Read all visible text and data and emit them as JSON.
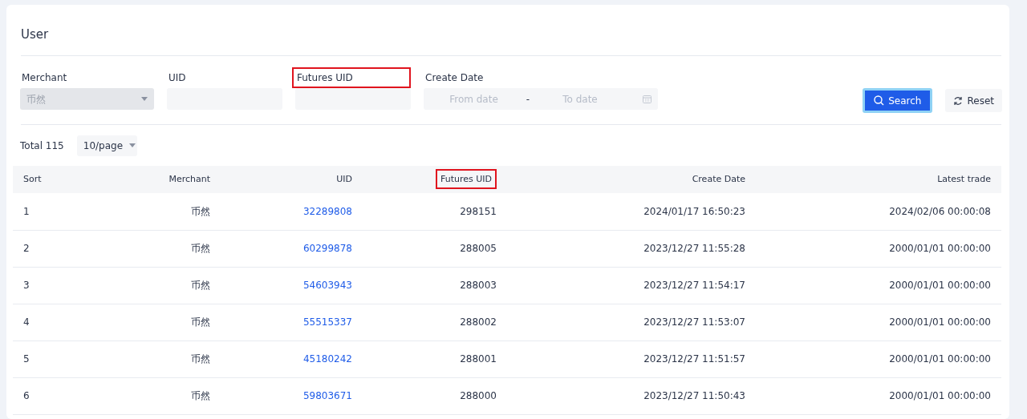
{
  "title": "User",
  "filters": [
    {
      "kind": "select",
      "label": "Merchant",
      "value": "币然",
      "disabled": true,
      "highlighted": false
    },
    {
      "kind": "input",
      "label": "UID",
      "highlighted": false
    },
    {
      "kind": "input",
      "label": "Futures UID",
      "highlighted": true
    },
    {
      "kind": "daterange",
      "label": "Create Date",
      "from_placeholder": "From date",
      "separator": "-",
      "to_placeholder": "To date",
      "highlighted": false
    }
  ],
  "buttons": [
    {
      "kind": "primary",
      "label": "Search"
    },
    {
      "kind": "secondary",
      "label": "Reset"
    }
  ],
  "total": "Total 115",
  "page_size": "10/page",
  "table": {
    "columns": [
      {
        "label": "Sort",
        "highlighted": false
      },
      {
        "label": "Merchant",
        "highlighted": false
      },
      {
        "label": "UID",
        "highlighted": false
      },
      {
        "label": "Futures UID",
        "highlighted": true
      },
      {
        "label": "Create Date",
        "highlighted": false
      },
      {
        "label": "Latest trade",
        "highlighted": false
      }
    ],
    "rows": [
      [
        "1",
        "币然",
        "32289808",
        "298151",
        "2024/01/17 16:50:23",
        "2024/02/06 00:00:08"
      ],
      [
        "2",
        "币然",
        "60299878",
        "288005",
        "2023/12/27 11:55:28",
        "2000/01/01 00:00:00"
      ],
      [
        "3",
        "币然",
        "54603943",
        "288003",
        "2023/12/27 11:54:17",
        "2000/01/01 00:00:00"
      ],
      [
        "4",
        "币然",
        "55515337",
        "288002",
        "2023/12/27 11:53:07",
        "2000/01/01 00:00:00"
      ],
      [
        "5",
        "币然",
        "45180242",
        "288001",
        "2023/12/27 11:51:57",
        "2000/01/01 00:00:00"
      ],
      [
        "6",
        "币然",
        "59803671",
        "288000",
        "2023/12/27 11:50:43",
        "2000/01/01 00:00:00"
      ]
    ]
  }
}
